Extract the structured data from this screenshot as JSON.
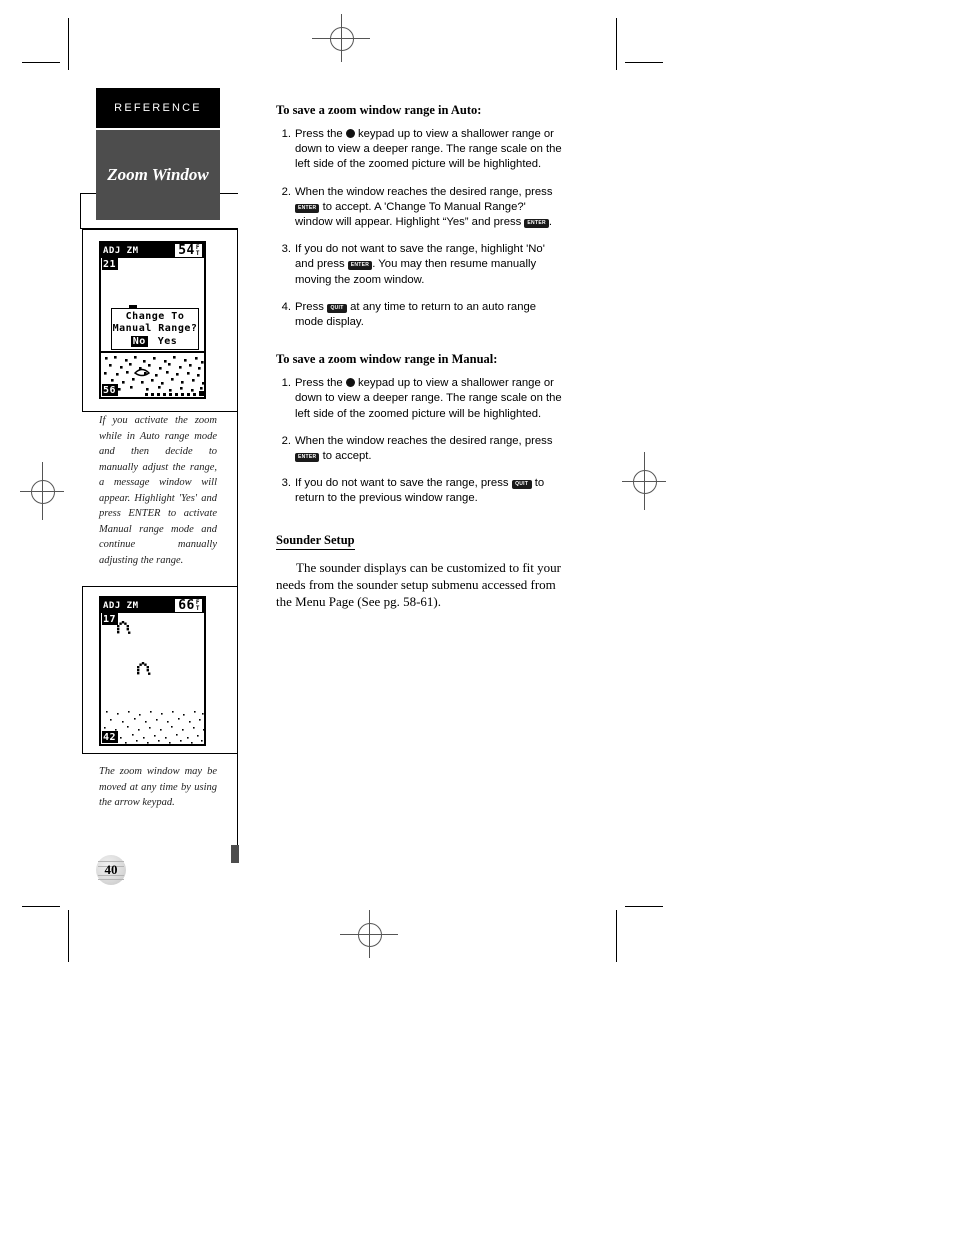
{
  "page": {
    "number": "40",
    "chapter_tab": "REFERENCE",
    "chapter_title": "Zoom Window"
  },
  "figures": [
    {
      "name": "zoom-auto-change-range",
      "lcd": {
        "header_label": "ADJ ZM",
        "depth_value": "54",
        "depth_unit_top": "F",
        "depth_unit_bottom": "T",
        "scale_top": "21",
        "scale_bottom": "56",
        "message": {
          "line1": "Change To",
          "line2": "Manual Range?",
          "option_selected": "No",
          "option_other": "Yes"
        }
      },
      "caption": "If you activate the zoom while in Auto range mode and then decide to manually adjust the range, a message window will appear. Highlight 'Yes' and press ENTER to activate Manual range mode and continue manually adjusting the range."
    },
    {
      "name": "zoom-window-moved",
      "lcd": {
        "header_label": "ADJ ZM",
        "depth_value": "66",
        "depth_unit_top": "F",
        "depth_unit_bottom": "T",
        "scale_top": "17",
        "scale_bottom": "42"
      },
      "caption": "The zoom window may be moved at any time by using the arrow keypad."
    }
  ],
  "main": {
    "section_auto": {
      "heading": "To save a zoom window range in Auto:",
      "steps": [
        {
          "num": "1.",
          "parts": [
            {
              "type": "text",
              "value": "Press the "
            },
            {
              "type": "rocker",
              "value": "rocker-keypad-icon"
            },
            {
              "type": "text",
              "value": " keypad up to view a shallower range or down to view a deeper range. The range scale on the left side of the zoomed picture will be highlighted."
            }
          ]
        },
        {
          "num": "2.",
          "parts": [
            {
              "type": "text",
              "value": "When the window reaches the desired range, press "
            },
            {
              "type": "key",
              "value": "ENTER"
            },
            {
              "type": "text",
              "value": " to accept. A 'Change To Manual Range?' window will appear. Highlight “Yes” and press "
            },
            {
              "type": "key",
              "value": "ENTER"
            },
            {
              "type": "text",
              "value": "."
            }
          ]
        },
        {
          "num": "3.",
          "parts": [
            {
              "type": "text",
              "value": "If you do not want to save the range, highlight 'No' and press "
            },
            {
              "type": "key",
              "value": "ENTER"
            },
            {
              "type": "text",
              "value": ". You may then resume manually moving the zoom window."
            }
          ]
        },
        {
          "num": "4.",
          "parts": [
            {
              "type": "text",
              "value": "Press "
            },
            {
              "type": "key",
              "value": "QUIT"
            },
            {
              "type": "text",
              "value": " at any time to return to an auto range mode display."
            }
          ]
        }
      ]
    },
    "section_manual": {
      "heading": "To save a zoom window range in Manual:",
      "steps": [
        {
          "num": "1.",
          "parts": [
            {
              "type": "text",
              "value": "Press the "
            },
            {
              "type": "rocker",
              "value": "rocker-keypad-icon"
            },
            {
              "type": "text",
              "value": " keypad up to view a shallower range or down to view a deeper range. The range scale on the left side of the zoomed picture will be highlighted."
            }
          ]
        },
        {
          "num": "2.",
          "parts": [
            {
              "type": "text",
              "value": "When the window reaches the desired range, press "
            },
            {
              "type": "key",
              "value": "ENTER"
            },
            {
              "type": "text",
              "value": " to accept."
            }
          ]
        },
        {
          "num": "3.",
          "parts": [
            {
              "type": "text",
              "value": "If you do not want to save the range, press "
            },
            {
              "type": "key",
              "value": "QUIT"
            },
            {
              "type": "text",
              "value": " to return to the previous window range."
            }
          ]
        }
      ]
    },
    "sounder_setup": {
      "heading": "Sounder Setup",
      "paragraph": "The sounder displays can be customized to fit your needs from the sounder setup submenu accessed from the Menu Page (See pg. 58-61)."
    }
  },
  "colors": {
    "tab_bg": "#000000",
    "chapter_bg": "#4d4d4d",
    "text": "#000000"
  }
}
